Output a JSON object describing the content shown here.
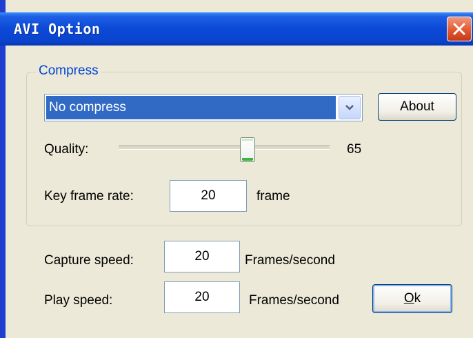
{
  "window": {
    "title": "AVI Option"
  },
  "compress": {
    "legend": "Compress",
    "codec_selected": "No compress",
    "about_label": "About",
    "quality_label": "Quality:",
    "quality_value": "65",
    "quality_level": 65,
    "key_frame_label": "Key frame rate:",
    "key_frame_value": "20",
    "key_frame_unit": "frame"
  },
  "speed": {
    "capture_label": "Capture speed:",
    "capture_value": "20",
    "capture_unit": "Frames/second",
    "play_label": "Play speed:",
    "play_value": "20",
    "play_unit": "Frames/second"
  },
  "buttons": {
    "ok_accel": "O",
    "ok_rest": "k"
  },
  "icons": {
    "close": "close-icon",
    "dropdown": "chevron-down-icon"
  },
  "colors": {
    "titlebar": "#0a44ce",
    "selection": "#316ac5",
    "legend": "#0046d5",
    "face": "#ece9d8"
  }
}
